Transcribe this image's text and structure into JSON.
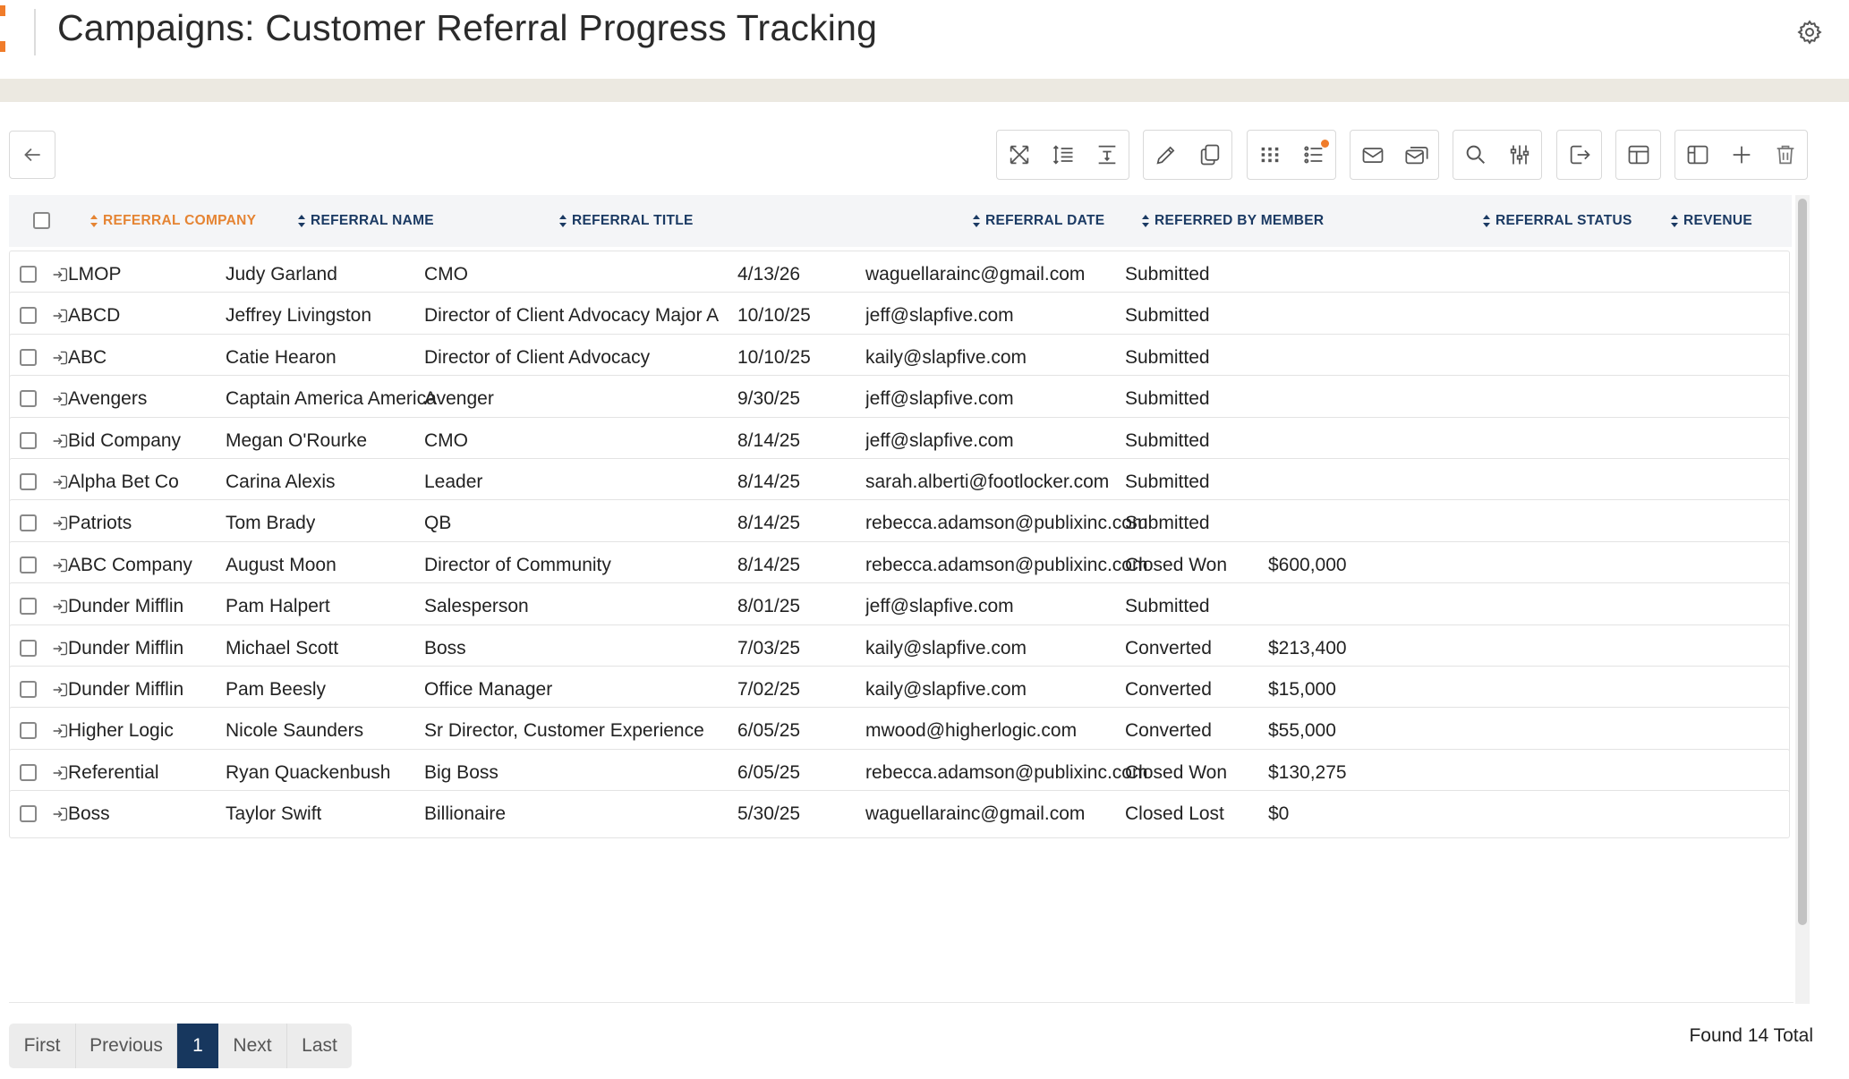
{
  "header": {
    "title": "Campaigns: Customer Referral Progress Tracking",
    "brand_color": "#f07c2a"
  },
  "toolbar": {
    "back_icon": "arrow-left-icon",
    "groups": [
      [
        "expand-icon",
        "row-height-icon",
        "text-height-icon"
      ],
      [
        "edit-icon",
        "copy-icon"
      ],
      [
        "grid-view-icon",
        "list-view-icon"
      ],
      [
        "email-icon",
        "bulk-email-icon"
      ],
      [
        "search-icon",
        "filter-sliders-icon"
      ],
      [
        "export-icon"
      ],
      [
        "layout-icon"
      ],
      [
        "panel-icon",
        "add-icon",
        "delete-icon"
      ]
    ]
  },
  "table": {
    "columns": [
      {
        "label": "REFERRAL COMPANY",
        "active": true
      },
      {
        "label": "REFERRAL NAME"
      },
      {
        "label": "REFERRAL TITLE"
      },
      {
        "label": "REFERRAL DATE"
      },
      {
        "label": "REFERRED BY MEMBER"
      },
      {
        "label": "REFERRAL STATUS"
      },
      {
        "label": "REVENUE"
      }
    ],
    "rows": [
      {
        "company": "LMOP",
        "name": "Judy Garland",
        "title": "CMO",
        "date": "4/13/26",
        "member": "waguellarainc@gmail.com",
        "status": "Submitted",
        "revenue": ""
      },
      {
        "company": "ABCD",
        "name": "Jeffrey Livingston",
        "title": "Director of Client Advocacy Major Accoun",
        "date": "10/10/25",
        "member": "jeff@slapfive.com",
        "status": "Submitted",
        "revenue": ""
      },
      {
        "company": "ABC",
        "name": "Catie Hearon",
        "title": "Director of Client Advocacy",
        "date": "10/10/25",
        "member": "kaily@slapfive.com",
        "status": "Submitted",
        "revenue": ""
      },
      {
        "company": "Avengers",
        "name": "Captain America America",
        "title": "Avenger",
        "date": "9/30/25",
        "member": "jeff@slapfive.com",
        "status": "Submitted",
        "revenue": ""
      },
      {
        "company": "Bid Company",
        "name": "Megan O'Rourke",
        "title": "CMO",
        "date": "8/14/25",
        "member": "jeff@slapfive.com",
        "status": "Submitted",
        "revenue": ""
      },
      {
        "company": "Alpha Bet Co",
        "name": "Carina Alexis",
        "title": "Leader",
        "date": "8/14/25",
        "member": "sarah.alberti@footlocker.com",
        "status": "Submitted",
        "revenue": ""
      },
      {
        "company": "Patriots",
        "name": "Tom Brady",
        "title": "QB",
        "date": "8/14/25",
        "member": "rebecca.adamson@publixinc.com",
        "status": "Submitted",
        "revenue": ""
      },
      {
        "company": "ABC Company",
        "name": "August Moon",
        "title": "Director of Community",
        "date": "8/14/25",
        "member": "rebecca.adamson@publixinc.com",
        "status": "Closed Won",
        "revenue": "$600,000"
      },
      {
        "company": "Dunder Mifflin",
        "name": "Pam Halpert",
        "title": "Salesperson",
        "date": "8/01/25",
        "member": "jeff@slapfive.com",
        "status": "Submitted",
        "revenue": ""
      },
      {
        "company": "Dunder Mifflin",
        "name": "Michael Scott",
        "title": "Boss",
        "date": "7/03/25",
        "member": "kaily@slapfive.com",
        "status": "Converted",
        "revenue": "$213,400"
      },
      {
        "company": "Dunder Mifflin",
        "name": "Pam Beesly",
        "title": "Office Manager",
        "date": "7/02/25",
        "member": "kaily@slapfive.com",
        "status": "Converted",
        "revenue": "$15,000"
      },
      {
        "company": "Higher Logic",
        "name": "Nicole Saunders",
        "title": "Sr Director, Customer Experience",
        "date": "6/05/25",
        "member": "mwood@higherlogic.com",
        "status": "Converted",
        "revenue": "$55,000"
      },
      {
        "company": "Referential",
        "name": "Ryan Quackenbush",
        "title": "Big Boss",
        "date": "6/05/25",
        "member": "rebecca.adamson@publixinc.com",
        "status": "Closed Won",
        "revenue": "$130,275"
      },
      {
        "company": "Boss",
        "name": "Taylor Swift",
        "title": "Billionaire",
        "date": "5/30/25",
        "member": "waguellarainc@gmail.com",
        "status": "Closed Lost",
        "revenue": "$0"
      }
    ]
  },
  "pagination": {
    "first": "First",
    "previous": "Previous",
    "current": "1",
    "next": "Next",
    "last": "Last"
  },
  "footer": {
    "found_text": "Found 14 Total"
  },
  "colors": {
    "accent": "#f07c2a",
    "header_text": "#1b3a63",
    "pager_current": "#17375e"
  }
}
